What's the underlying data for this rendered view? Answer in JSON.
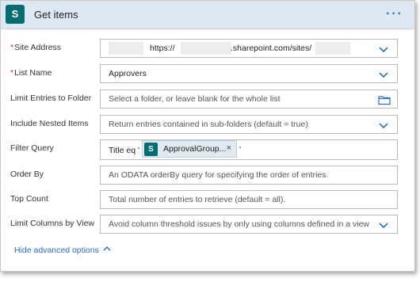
{
  "header": {
    "icon_letter": "S",
    "title": "Get items",
    "more_label": "···"
  },
  "fields": {
    "site_address": {
      "label": "Site Address",
      "required": "*",
      "value_prefix": "https://",
      "value_mid": ".sharepoint.com/sites/"
    },
    "list_name": {
      "label": "List Name",
      "required": "*",
      "value": "Approvers"
    },
    "limit_folder": {
      "label": "Limit Entries to Folder",
      "placeholder": "Select a folder, or leave blank for the whole list"
    },
    "nested_items": {
      "label": "Include Nested Items",
      "placeholder": "Return entries contained in sub-folders (default = true)"
    },
    "filter_query": {
      "label": "Filter Query",
      "prefix": "Title eq '",
      "token_icon": "S",
      "token_label": "ApprovalGroup...",
      "token_close": "×",
      "suffix": "'"
    },
    "order_by": {
      "label": "Order By",
      "placeholder": "An ODATA orderBy query for specifying the order of entries."
    },
    "top_count": {
      "label": "Top Count",
      "placeholder": "Total number of entries to retrieve (default = all)."
    },
    "limit_columns": {
      "label": "Limit Columns by View",
      "placeholder": "Avoid column threshold issues by only using columns defined in a view"
    }
  },
  "footer": {
    "hide_advanced": "Hide advanced options"
  },
  "colors": {
    "accent": "#2a6fbf",
    "header_bg": "#dde8f2",
    "sharepoint": "#036c70",
    "required": "#d13438"
  }
}
